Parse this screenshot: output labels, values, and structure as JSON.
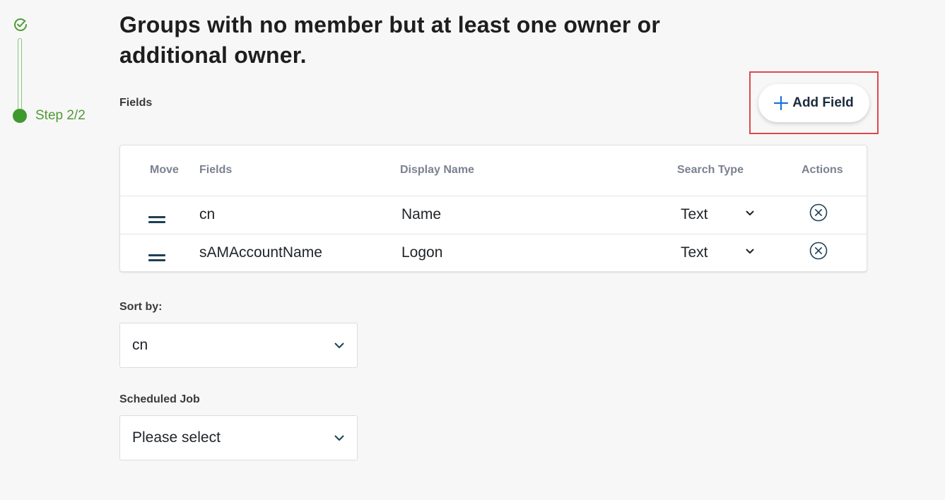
{
  "stepper": {
    "step_label": "Step 2/2",
    "color_done": "#4f9a34",
    "icons": [
      "check-circle-icon",
      "dot-icon"
    ]
  },
  "title": "Groups with no member but at least one owner or additional owner.",
  "fields_label": "Fields",
  "add_field_label": "Add Field",
  "table": {
    "headers": {
      "move": "Move",
      "fields": "Fields",
      "display_name": "Display Name",
      "search_type": "Search Type",
      "actions": "Actions"
    },
    "rows": [
      {
        "field": "cn",
        "display_name": "Name",
        "search_type": "Text"
      },
      {
        "field": "sAMAccountName",
        "display_name": "Logon",
        "search_type": "Text"
      }
    ]
  },
  "sort_by": {
    "label": "Sort by:",
    "value": "cn"
  },
  "scheduled_job": {
    "label": "Scheduled Job",
    "value": "Please select"
  },
  "colors": {
    "accent_blue": "#1a73d9",
    "highlight_red": "#e0474c",
    "step_green": "#3e9a2c"
  }
}
